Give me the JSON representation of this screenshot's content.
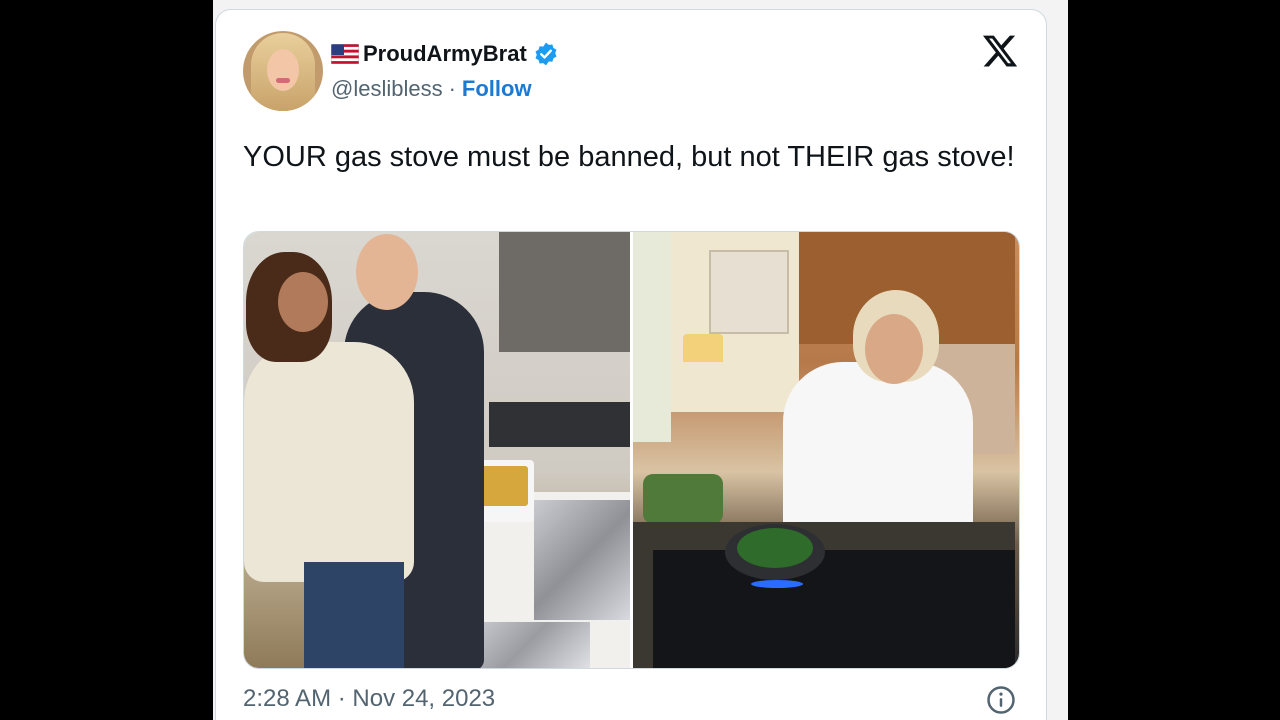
{
  "tweet": {
    "author": {
      "display_name": "ProudArmyBrat",
      "handle": "@leslibless",
      "flag_icon": "us-flag-icon",
      "verified_icon": "verified-badge-icon",
      "verified_color": "#1d9bf0"
    },
    "separator": "·",
    "follow_label": "Follow",
    "text": "YOUR gas stove must be banned, but not THEIR gas stove!",
    "timestamp": "2:28 AM · Nov 24, 2023",
    "brand_icon": "x-logo-icon",
    "info_icon": "info-icon",
    "accent_color": "#1d7ad2"
  }
}
